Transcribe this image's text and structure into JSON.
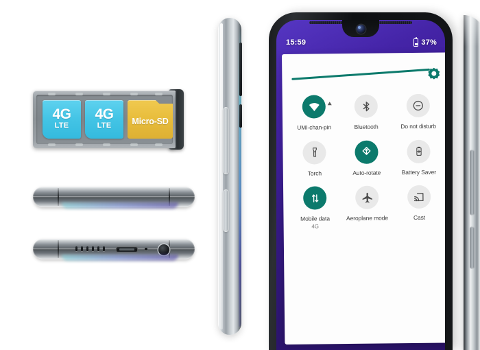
{
  "product": {
    "sim_tray": {
      "name": "Dual SIM + microSD tray",
      "cards": [
        {
          "id": "sim-card-1",
          "type": "sim",
          "primary": "4G",
          "secondary": "LTE",
          "color": "#45c5e6"
        },
        {
          "id": "sim-card-2",
          "type": "sim",
          "primary": "4G",
          "secondary": "LTE",
          "color": "#45c5e6"
        },
        {
          "id": "sd-card",
          "type": "microsd",
          "label": "Micro-SD",
          "color": "#e8bd3c"
        }
      ]
    },
    "edge_views": [
      {
        "id": "edge-top-view",
        "name": "top-edge-view"
      },
      {
        "id": "edge-bottom-view",
        "name": "bottom-edge-view",
        "ports": [
          "speaker-grille",
          "micro-usb-port",
          "microphone-hole",
          "headphone-jack"
        ]
      }
    ],
    "side_profile": {
      "name": "side-profile-view",
      "buttons": [
        "volume-rocker",
        "power-button"
      ]
    }
  },
  "phone": {
    "status_bar": {
      "time": "15:59",
      "battery_percent": "37%",
      "battery_icon": "battery-icon"
    },
    "notch": {
      "camera_icon": "front-camera-icon",
      "earpiece_icon": "earpiece-speaker-icon"
    },
    "wallpaper_color": "#3f1f9e",
    "accent_color": "#0c7a6c",
    "inactive_tile_color": "#e9e9e9"
  },
  "quick_settings": {
    "brightness": {
      "name": "brightness-slider",
      "value": 93,
      "handle_icon": "brightness-sun-icon",
      "track_color": "#0c7a6c"
    },
    "tiles": [
      {
        "label": "UMI-chan-pin",
        "sub": "",
        "state": "on",
        "icon": "wifi-icon",
        "expand": true
      },
      {
        "label": "Bluetooth",
        "sub": "",
        "state": "off",
        "icon": "bluetooth-icon",
        "expand": false
      },
      {
        "label": "Do not disturb",
        "sub": "",
        "state": "off",
        "icon": "do-not-disturb-icon",
        "expand": false
      },
      {
        "label": "Torch",
        "sub": "",
        "state": "off",
        "icon": "torch-icon",
        "expand": false
      },
      {
        "label": "Auto-rotate",
        "sub": "",
        "state": "on",
        "icon": "auto-rotate-icon",
        "expand": false
      },
      {
        "label": "Battery Saver",
        "sub": "",
        "state": "off",
        "icon": "battery-saver-icon",
        "expand": false
      },
      {
        "label": "Mobile data",
        "sub": "4G",
        "state": "on",
        "icon": "mobile-data-icon",
        "expand": false
      },
      {
        "label": "Aeroplane mode",
        "sub": "",
        "state": "off",
        "icon": "aeroplane-icon",
        "expand": false
      },
      {
        "label": "Cast",
        "sub": "",
        "state": "off",
        "icon": "cast-icon",
        "expand": false
      }
    ]
  }
}
